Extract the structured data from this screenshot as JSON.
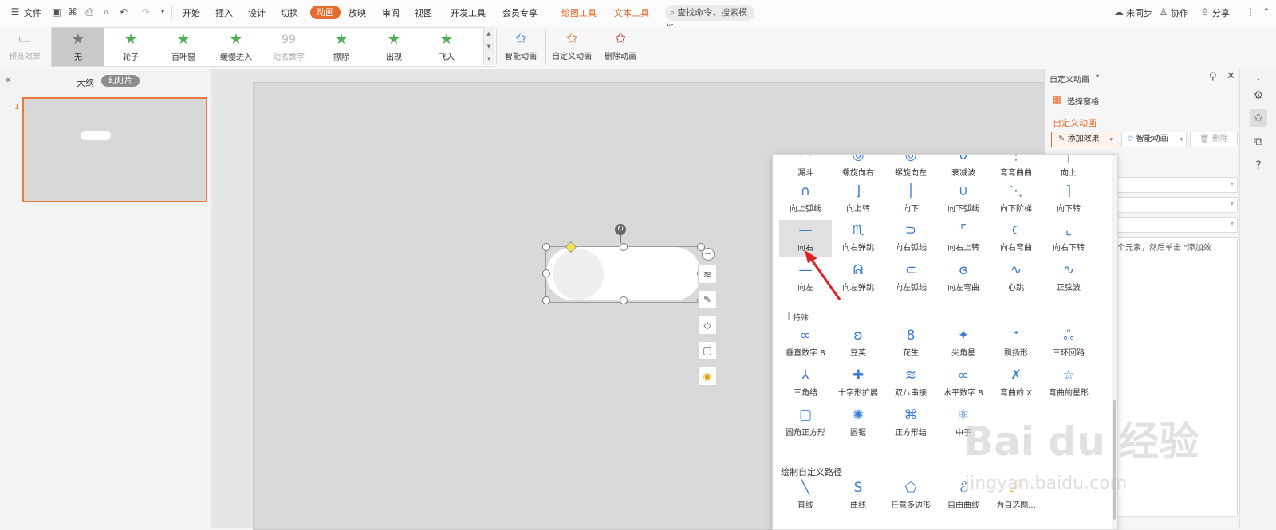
{
  "menubar": {
    "file_label": "文件",
    "tabs": [
      "开始",
      "插入",
      "设计",
      "切换",
      "动画",
      "放映",
      "审阅",
      "视图",
      "开发工具",
      "会员专享",
      "绘图工具",
      "文本工具"
    ],
    "search_placeholder": "查找命令、搜索模板",
    "right": {
      "sync": "未同步",
      "collab": "协作",
      "share": "分享"
    }
  },
  "ribbon": {
    "preview": "预览效果",
    "gallery": [
      "无",
      "轮子",
      "百叶窗",
      "缓慢进入",
      "动态数字",
      "擦除",
      "出现",
      "飞入"
    ],
    "smart": "智能动画",
    "custom": "自定义动画",
    "delete": "删除动画"
  },
  "leftpanel": {
    "outline": "大纲",
    "slides": "幻灯片",
    "slide_number": "1"
  },
  "popup": {
    "row1": [
      "漏斗",
      "螺旋向右",
      "螺旋向左",
      "衰减波",
      "弯弯曲曲",
      "向上"
    ],
    "row2": [
      "向上弧线",
      "向上转",
      "向下",
      "向下弧线",
      "向下阶梯",
      "向下转"
    ],
    "row3": [
      "向右",
      "向右弹跳",
      "向右弧线",
      "向右上转",
      "向右弯曲",
      "向右下转"
    ],
    "row4": [
      "向左",
      "向左弹跳",
      "向左弧线",
      "向左弯曲",
      "心跳",
      "正弦波"
    ],
    "special_title": "特殊",
    "special_row1": [
      "垂直数字 8",
      "豆荚",
      "花生",
      "尖角星",
      "飘扬形",
      "三环回路"
    ],
    "special_row2": [
      "三角结",
      "十字形扩展",
      "双八串接",
      "水平数字 8",
      "弯曲的 X",
      "弯曲的星形"
    ],
    "special_row3": [
      "圆角正方形",
      "圆锯",
      "正方形结",
      "中子"
    ],
    "draw_title": "绘制自定义路径",
    "draw_row": [
      "直线",
      "曲线",
      "任意多边形",
      "自由曲线",
      "为自选图..."
    ]
  },
  "rightpane": {
    "title": "自定义动画",
    "select_pane": "选择窗格",
    "section_title": "自定义动画",
    "add_effect": "添加效果",
    "smart_anim": "智能动画",
    "delete": "删除",
    "hint": "个元素，然后单击 \"添加效"
  },
  "watermark": {
    "brand": "Bai du 经验",
    "url": "jingyan.baidu.com"
  },
  "colors": {
    "accent": "#e46c2e",
    "path_icon": "#3b7dd8"
  }
}
